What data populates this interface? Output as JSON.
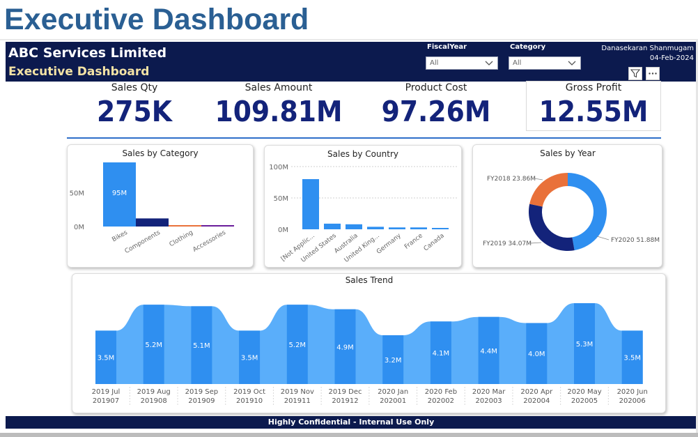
{
  "slide": {
    "title": "Executive Dashboard"
  },
  "header": {
    "company": "ABC Services Limited",
    "dashboard_name": "Executive Dashboard",
    "filters": [
      {
        "label": "FiscalYear",
        "value": "All"
      },
      {
        "label": "Category",
        "value": "All"
      }
    ],
    "user": "Danasekaran Shanmugam",
    "date": "04-Feb-2024",
    "icons": {
      "filter": "filter-icon",
      "more": "more-options-icon"
    }
  },
  "kpis": [
    {
      "label": "Sales Qty",
      "value": "275K"
    },
    {
      "label": "Sales Amount",
      "value": "109.81M"
    },
    {
      "label": "Product Cost",
      "value": "97.26M"
    },
    {
      "label": "Gross Profit",
      "value": "12.55M"
    }
  ],
  "footer": {
    "text": "Highly Confidential - Internal Use Only"
  },
  "colors": {
    "navy": "#0c1a4e",
    "accent_blue": "#2f8ff0",
    "dark_blue": "#13237a",
    "orange": "#e9713a",
    "purple": "#6a1d9a",
    "light_blue": "#5aaefa",
    "kpi_text": "#13237a",
    "subtitle_yellow": "#f4e3a5"
  },
  "chart_data": [
    {
      "type": "bar",
      "title": "Sales by Category",
      "categories": [
        "Bikes",
        "Components",
        "Clothing",
        "Accessories"
      ],
      "values": [
        95,
        12,
        2,
        1
      ],
      "colors": [
        "#2f8ff0",
        "#13237a",
        "#e9713a",
        "#6a1d9a"
      ],
      "data_labels": [
        "95M",
        "",
        "",
        ""
      ],
      "yticks": [
        "0M",
        "50M"
      ],
      "ylim": [
        0,
        95
      ],
      "grid": false
    },
    {
      "type": "bar",
      "title": "Sales by Country",
      "categories": [
        "[Not Applic...",
        "United States",
        "Australia",
        "United King...",
        "Germany",
        "France",
        "Canada"
      ],
      "values": [
        80,
        9,
        8,
        4,
        3,
        3,
        2
      ],
      "color": "#2f8ff0",
      "yticks": [
        "0M",
        "50M",
        "100M"
      ],
      "ylim": [
        0,
        100
      ],
      "grid": true
    },
    {
      "type": "pie",
      "donut": true,
      "title": "Sales by Year",
      "slices": [
        {
          "label": "FY2020 51.88M",
          "value": 51.88,
          "color": "#2f8ff0"
        },
        {
          "label": "FY2019 34.07M",
          "value": 34.07,
          "color": "#13237a"
        },
        {
          "label": "FY2018 23.86M",
          "value": 23.86,
          "color": "#e9713a"
        }
      ]
    },
    {
      "type": "bar",
      "title": "Sales Trend",
      "area_ribbon": true,
      "categories": [
        {
          "label": "2019 Jul",
          "sub": "201907"
        },
        {
          "label": "2019 Aug",
          "sub": "201908"
        },
        {
          "label": "2019 Sep",
          "sub": "201909"
        },
        {
          "label": "2019 Oct",
          "sub": "201910"
        },
        {
          "label": "2019 Nov",
          "sub": "201911"
        },
        {
          "label": "2019 Dec",
          "sub": "201912"
        },
        {
          "label": "2020 Jan",
          "sub": "202001"
        },
        {
          "label": "2020 Feb",
          "sub": "202002"
        },
        {
          "label": "2020 Mar",
          "sub": "202003"
        },
        {
          "label": "2020 Apr",
          "sub": "202004"
        },
        {
          "label": "2020 May",
          "sub": "202005"
        },
        {
          "label": "2020 Jun",
          "sub": "202006"
        }
      ],
      "values": [
        3.5,
        5.2,
        5.1,
        3.5,
        5.2,
        4.9,
        3.2,
        4.1,
        4.4,
        4.0,
        5.3,
        3.5
      ],
      "data_labels": [
        "3.5M",
        "5.2M",
        "5.1M",
        "3.5M",
        "5.2M",
        "4.9M",
        "3.2M",
        "4.1M",
        "4.4M",
        "4.0M",
        "5.3M",
        "3.5M"
      ],
      "ylim": [
        0,
        5.3
      ]
    }
  ]
}
